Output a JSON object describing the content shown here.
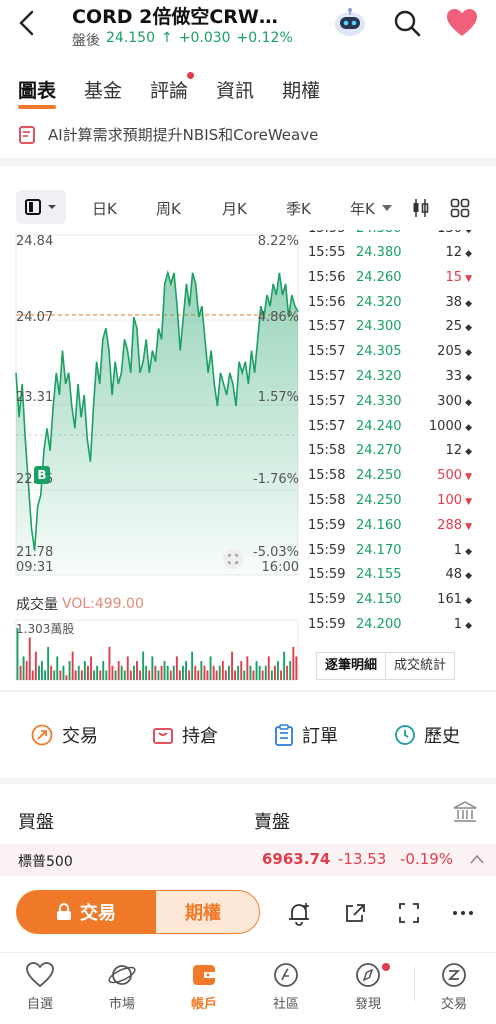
{
  "header": {
    "title": "CORD  2倍做空CRW…",
    "session_label": "盤後",
    "price": "24.150",
    "change": "+0.030",
    "change_pct": "+0.12%",
    "up_arrow": "↑"
  },
  "tabs": [
    {
      "label": "圖表",
      "active": true
    },
    {
      "label": "基金",
      "active": false
    },
    {
      "label": "評論",
      "active": false,
      "dot": true
    },
    {
      "label": "資訊",
      "active": false
    },
    {
      "label": "期權",
      "active": false
    }
  ],
  "news": {
    "text": "AI計算需求預期提升NBIS和CoreWeave"
  },
  "periods": [
    "日K",
    "周K",
    "月K",
    "季K",
    "年K"
  ],
  "chart": {
    "price_labels": [
      "24.84",
      "24.07",
      "23.31",
      "22.55",
      "21.78"
    ],
    "pct_labels": [
      "8.22%",
      "4.86%",
      "1.57%",
      "-1.76%",
      "-5.03%"
    ],
    "time_start": "09:31",
    "time_end": "16:00",
    "buy_marker": "B",
    "volume_title": "成交量",
    "volume_value": "VOL:499.00",
    "volume_max": "1.303萬股",
    "colors": {
      "up": "#1aa064",
      "down": "#e23d4b",
      "accent": "#f07a2a"
    }
  },
  "chart_data": {
    "type": "area",
    "x_start": "09:31",
    "x_end": "16:00",
    "ylim": [
      21.78,
      24.84
    ],
    "reference_price": 24.12,
    "values": [
      23.6,
      23.2,
      23.5,
      23.0,
      22.6,
      22.2,
      22.0,
      22.4,
      22.5,
      22.9,
      23.1,
      22.9,
      23.3,
      23.6,
      23.4,
      23.8,
      23.5,
      23.6,
      23.3,
      23.1,
      23.5,
      23.2,
      23.4,
      23.0,
      22.8,
      23.3,
      23.7,
      23.5,
      23.9,
      24.0,
      23.8,
      23.4,
      23.7,
      23.5,
      23.6,
      23.9,
      23.8,
      23.6,
      24.1,
      24.0,
      23.6,
      23.7,
      23.9,
      23.6,
      23.8,
      23.7,
      24.0,
      23.9,
      24.4,
      24.5,
      24.4,
      24.5,
      24.2,
      23.8,
      24.1,
      24.4,
      24.2,
      24.5,
      24.4,
      24.1,
      24.2,
      23.9,
      23.6,
      23.8,
      23.5,
      23.3,
      23.6,
      23.5,
      23.4,
      23.6,
      23.5,
      23.3,
      23.7,
      23.6,
      23.7,
      23.5,
      23.8,
      23.6,
      23.9,
      24.2,
      24.1,
      24.3,
      24.2,
      24.4,
      24.3,
      24.5,
      24.3,
      24.4,
      24.1,
      24.3,
      24.2,
      24.15
    ],
    "volumes": [
      1.1,
      0.3,
      0.5,
      0.4,
      0.9,
      0.2,
      0.6,
      0.3,
      0.4,
      0.2,
      0.7,
      0.3,
      0.2,
      0.5,
      0.2,
      0.3,
      0.1,
      0.4,
      0.6,
      0.2,
      0.3,
      0.2,
      0.4,
      0.3,
      0.5,
      0.2,
      0.3,
      0.2,
      0.4,
      0.2,
      0.7,
      0.3,
      0.2,
      0.4,
      0.3,
      0.2,
      0.5,
      0.2,
      0.3,
      0.4,
      0.2,
      0.6,
      0.3,
      0.2,
      0.5,
      0.3,
      0.2,
      0.3,
      0.4,
      0.3,
      0.2,
      0.3,
      0.5,
      0.2,
      0.3,
      0.4,
      0.2,
      0.6,
      0.3,
      0.2,
      0.4,
      0.3,
      0.2,
      0.5,
      0.3,
      0.2,
      0.3,
      0.4,
      0.2,
      0.3,
      0.6,
      0.2,
      0.3,
      0.4,
      0.2,
      0.5,
      0.3,
      0.2,
      0.4,
      0.3,
      0.2,
      0.3,
      0.5,
      0.2,
      0.3,
      0.4,
      0.2,
      0.6,
      0.3,
      0.4,
      0.7,
      0.5
    ]
  },
  "ticks": [
    {
      "time": "15:55",
      "price": "24.380",
      "vol": "12",
      "color": "dark"
    },
    {
      "time": "15:56",
      "price": "24.260",
      "vol": "15",
      "color": "red"
    },
    {
      "time": "15:56",
      "price": "24.320",
      "vol": "38",
      "color": "dark"
    },
    {
      "time": "15:57",
      "price": "24.300",
      "vol": "25",
      "color": "dark"
    },
    {
      "time": "15:57",
      "price": "24.305",
      "vol": "205",
      "color": "dark"
    },
    {
      "time": "15:57",
      "price": "24.320",
      "vol": "33",
      "color": "dark"
    },
    {
      "time": "15:57",
      "price": "24.330",
      "vol": "300",
      "color": "dark"
    },
    {
      "time": "15:57",
      "price": "24.240",
      "vol": "1000",
      "color": "dark"
    },
    {
      "time": "15:58",
      "price": "24.270",
      "vol": "12",
      "color": "dark"
    },
    {
      "time": "15:58",
      "price": "24.250",
      "vol": "500",
      "color": "red"
    },
    {
      "time": "15:58",
      "price": "24.250",
      "vol": "100",
      "color": "red"
    },
    {
      "time": "15:59",
      "price": "24.160",
      "vol": "288",
      "color": "red"
    },
    {
      "time": "15:59",
      "price": "24.170",
      "vol": "1",
      "color": "dark"
    },
    {
      "time": "15:59",
      "price": "24.155",
      "vol": "48",
      "color": "dark"
    },
    {
      "time": "15:59",
      "price": "24.150",
      "vol": "161",
      "color": "dark"
    },
    {
      "time": "15:59",
      "price": "24.200",
      "vol": "1",
      "color": "dark"
    }
  ],
  "tick_buttons": {
    "detail": "逐筆明細",
    "stats": "成交統計"
  },
  "actions": {
    "trade": "交易",
    "position": "持倉",
    "order": "訂單",
    "history": "歷史"
  },
  "book": {
    "bid": "買盤",
    "ask": "賣盤"
  },
  "index": {
    "name": "標普500",
    "value": "6963.74",
    "change": "-13.53",
    "pct": "-0.19%"
  },
  "bottom_actions": {
    "trade": "交易",
    "options": "期權"
  },
  "nav": [
    {
      "label": "自選",
      "icon": "heart-icon"
    },
    {
      "label": "市場",
      "icon": "planet-icon"
    },
    {
      "label": "帳戶",
      "icon": "wallet-icon",
      "active": true
    },
    {
      "label": "社區",
      "icon": "community-icon"
    },
    {
      "label": "發現",
      "icon": "compass-icon",
      "dot": true
    },
    {
      "label": "交易",
      "icon": "trade-icon"
    }
  ]
}
